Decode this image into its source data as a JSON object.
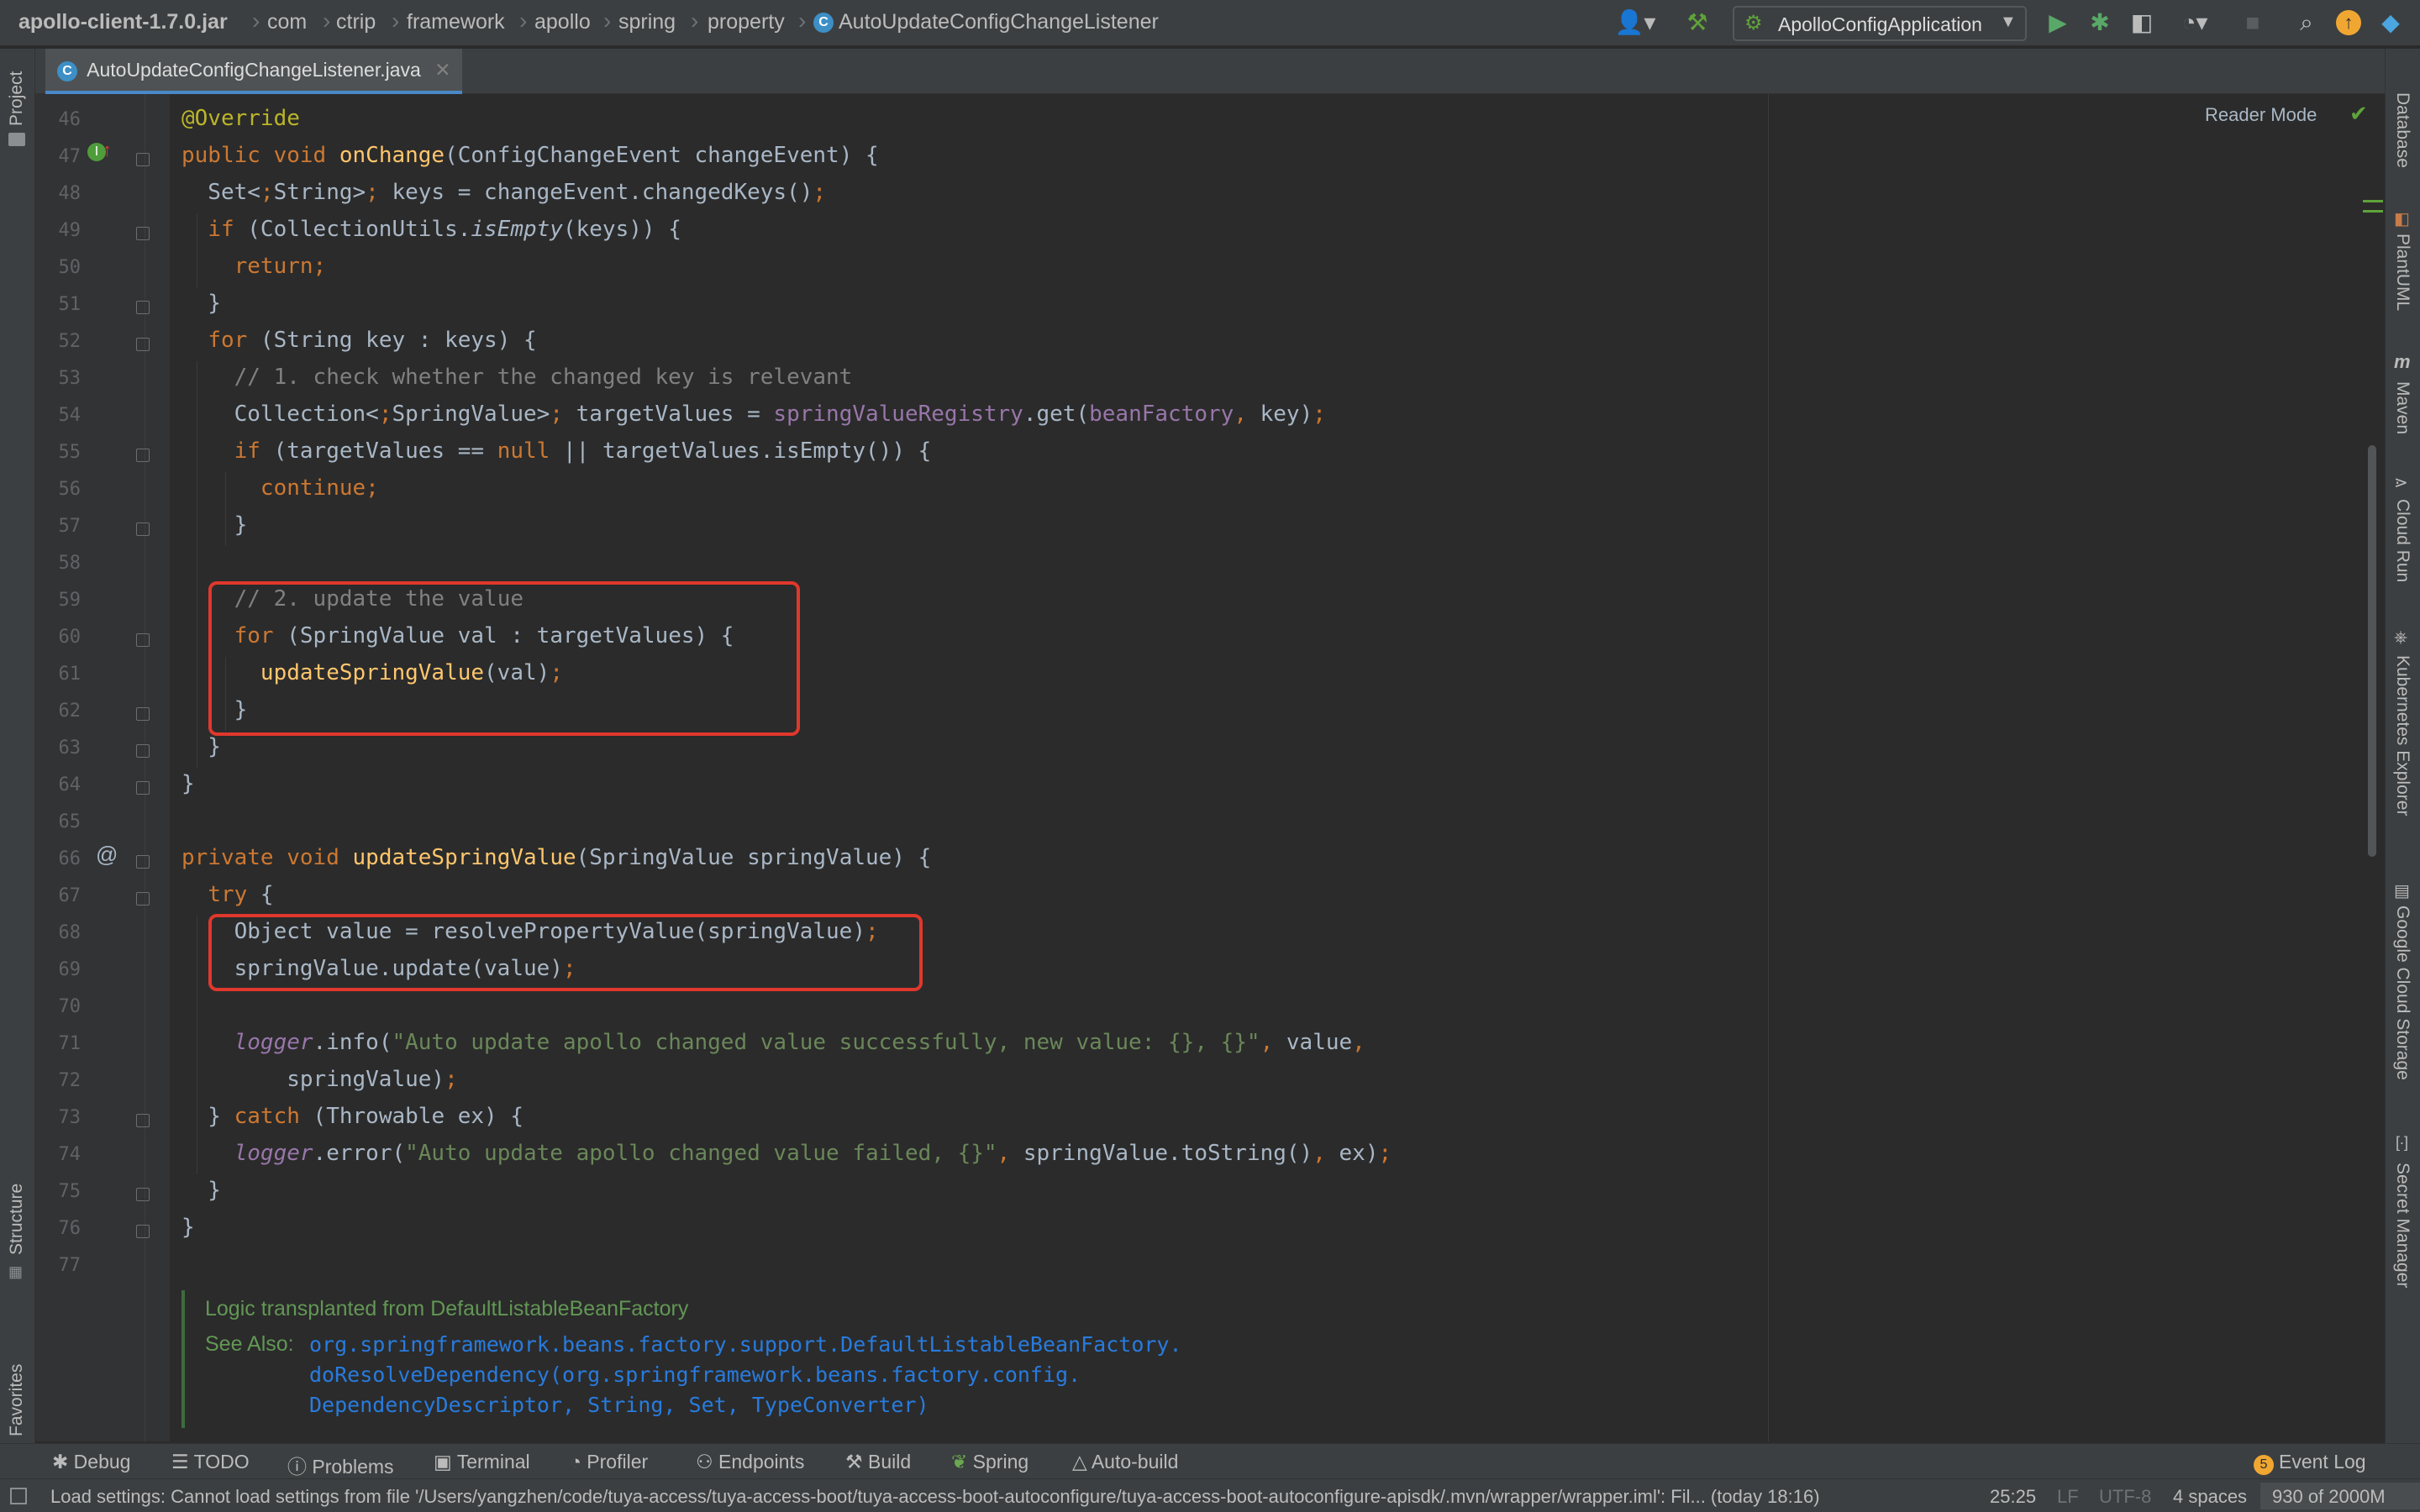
{
  "breadcrumb": {
    "items": [
      "apollo-client-1.7.0.jar",
      "com",
      "ctrip",
      "framework",
      "apollo",
      "spring",
      "property"
    ],
    "class_name": "AutoUpdateConfigChangeListener"
  },
  "run_config": {
    "name": "ApolloConfigApplication"
  },
  "editor_tab": {
    "title": "AutoUpdateConfigChangeListener.java"
  },
  "reader_mode": "Reader Mode",
  "left_tools": [
    "Project",
    "Structure",
    "Favorites"
  ],
  "right_tools": [
    "Database",
    "PlantUML",
    "Maven",
    "Cloud Run",
    "Kubernetes Explorer",
    "Google Cloud Storage",
    "Secret Manager"
  ],
  "code": {
    "line_numbers": [
      "46",
      "47",
      "48",
      "49",
      "50",
      "51",
      "52",
      "53",
      "54",
      "55",
      "56",
      "57",
      "58",
      "59",
      "60",
      "61",
      "62",
      "63",
      "64",
      "65",
      "66",
      "67",
      "68",
      "69",
      "70",
      "71",
      "72",
      "73",
      "74",
      "75",
      "76",
      "77"
    ],
    "lines": [
      "@Override",
      "public void onChange(ConfigChangeEvent changeEvent) {",
      "  Set<String> keys = changeEvent.changedKeys();",
      "  if (CollectionUtils.isEmpty(keys)) {",
      "    return;",
      "  }",
      "  for (String key : keys) {",
      "    // 1. check whether the changed key is relevant",
      "    Collection<SpringValue> targetValues = springValueRegistry.get(beanFactory, key);",
      "    if (targetValues == null || targetValues.isEmpty()) {",
      "      continue;",
      "    }",
      "",
      "    // 2. update the value",
      "    for (SpringValue val : targetValues) {",
      "      updateSpringValue(val);",
      "    }",
      "  }",
      "}",
      "",
      "private void updateSpringValue(SpringValue springValue) {",
      "  try {",
      "    Object value = resolvePropertyValue(springValue);",
      "    springValue.update(value);",
      "",
      "    logger.info(\"Auto update apollo changed value successfully, new value: {}, {}\", value,",
      "        springValue);",
      "  } catch (Throwable ex) {",
      "    logger.error(\"Auto update apollo changed value failed, {}\", springValue.toString(), ex);",
      "  }",
      "}",
      ""
    ]
  },
  "doc_comment": {
    "text": "Logic transplanted from DefaultListableBeanFactory",
    "see_also_label": "See Also:",
    "see_also_lines": [
      "org.springframework.beans.factory.support.DefaultListableBeanFactory.",
      "doResolveDependency(org.springframework.beans.factory.config.",
      "DependencyDescriptor, String, Set, TypeConverter)"
    ]
  },
  "tool_windows": [
    "Debug",
    "TODO",
    "Problems",
    "Terminal",
    "Profiler",
    "Endpoints",
    "Build",
    "Spring",
    "Auto-build"
  ],
  "event_log": {
    "count": "5",
    "label": "Event Log"
  },
  "status": {
    "message": "Load settings: Cannot load settings from file '/Users/yangzhen/code/tuya-access/tuya-access-boot/tuya-access-boot-autoconfigure/tuya-access-boot-autoconfigure-apisdk/.mvn/wrapper/wrapper.iml': Fil... (today 18:16)",
    "position": "25:25",
    "line_sep": "LF",
    "encoding": "UTF-8",
    "indent": "4 spaces",
    "memory": "930 of 2000M"
  },
  "colors": {
    "editor_bg": "#2b2b2b",
    "panel_bg": "#3c3f41",
    "keyword": "#cc7832",
    "method": "#ffc66d",
    "comment": "#808080",
    "string": "#6a8759",
    "field": "#9876aa",
    "highlight_box": "#e0382c"
  }
}
